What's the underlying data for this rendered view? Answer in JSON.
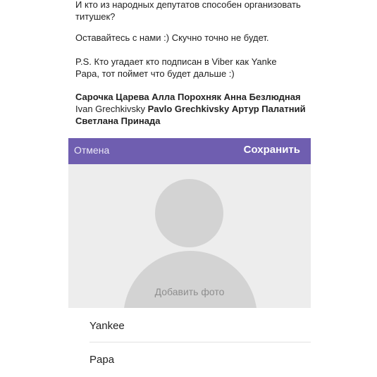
{
  "post": {
    "paragraph1": "И кто из народных депутатов способен организовать титушек?",
    "paragraph2": "Оставайтесь с нами :) Скучно точно не будет.",
    "paragraph3": "P.S. Кто угадает кто подписан в Viber как Yanke Papa, тот поймет что будет дальше :)",
    "tags": {
      "bold1": "Сарочка Царева Алла Порохняк Анна Безлюдная",
      "plain": "Ivan Grechkivsky",
      "bold2": "Pavlo Grechkivsky Артур Палатний Светлана Принада"
    }
  },
  "contact_edit": {
    "cancel_label": "Отмена",
    "save_label": "Сохранить",
    "add_photo_label": "Добавить фото",
    "first_name": "Yankee",
    "last_name": "Papa"
  },
  "colors": {
    "header_bar": "#6f5eb0",
    "photo_bg": "#ededed",
    "avatar_placeholder": "#d3d3d3"
  },
  "icons": [
    "avatar-placeholder-icon"
  ]
}
